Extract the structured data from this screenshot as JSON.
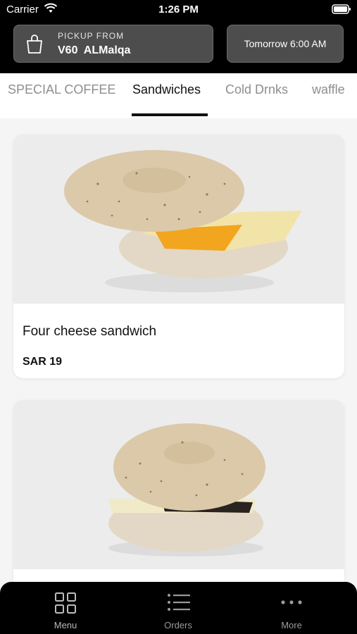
{
  "status_bar": {
    "carrier": "Carrier",
    "time": "1:26 PM"
  },
  "header": {
    "pickup_label": "PICKUP FROM",
    "store_name": "V60  ALMalqa",
    "pickup_time": "Tomorrow 6:00 AM"
  },
  "tabs": [
    {
      "label": "SPECIAL COFFEE"
    },
    {
      "label": "Sandwiches"
    },
    {
      "label": "Cold Drnks"
    },
    {
      "label": "waffle"
    }
  ],
  "active_tab": "Sandwiches",
  "products": [
    {
      "name": "Four cheese sandwich",
      "price": "SAR 19"
    },
    {
      "name": ""
    }
  ],
  "bottom_nav": [
    {
      "label": "Menu",
      "icon": "grid-icon"
    },
    {
      "label": "Orders",
      "icon": "list-icon"
    },
    {
      "label": "More",
      "icon": "more-dots-icon"
    }
  ],
  "colors": {
    "header_bg": "#000000",
    "button_bg": "#4d4d4d",
    "page_bg": "#f5f5f5",
    "active_tab": "#111111"
  }
}
